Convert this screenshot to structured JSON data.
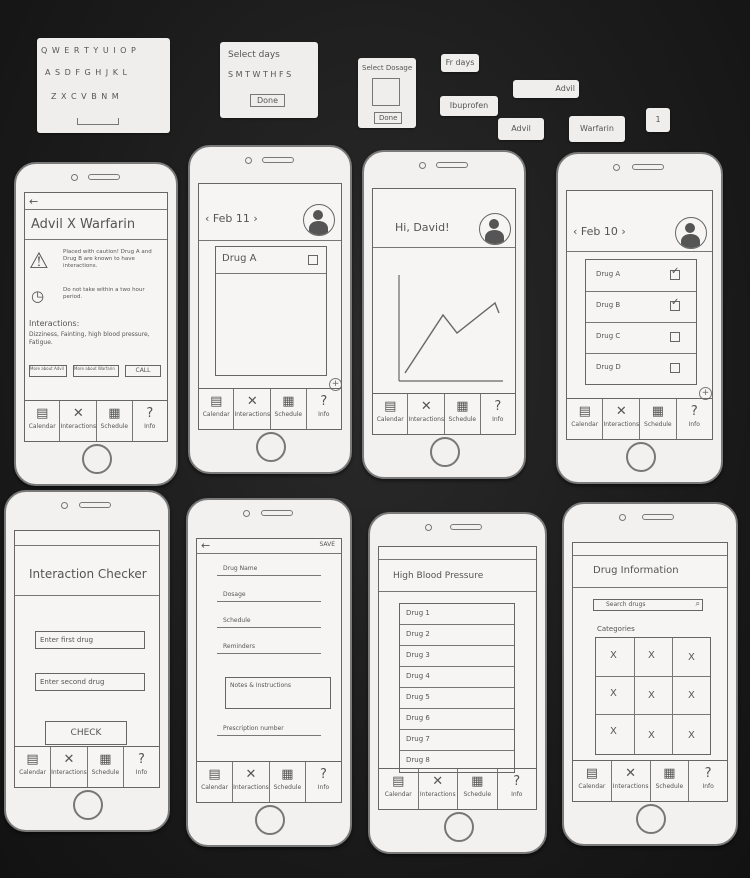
{
  "notes": {
    "keyboard_rows": [
      "Q W E R T Y U I O P",
      "A S D F G H J K L",
      "Z X C V B N M"
    ],
    "select_days_title": "Select days",
    "select_days_letters": "S M T W T H F S",
    "select_days_done": "Done",
    "select_dosage_title": "Select Dosage",
    "select_dosage_done": "Done",
    "tag_friday": "Fr days",
    "tag_ibuprofen": "Ibuprofen",
    "tag_advil_a": "Advil",
    "tag_advil_b": "Advil",
    "tag_warfarin": "Warfarin",
    "tag_one": "1"
  },
  "tabs": [
    "Calendar",
    "Interactions",
    "Schedule",
    "Info"
  ],
  "screens": {
    "interaction_detail": {
      "title": "Advil X Warfarin",
      "warning": "Placed with caution! Drug A and Drug B are known to have interactions.",
      "time_note": "Do not take within a two hour period.",
      "interactions_label": "Interactions:",
      "interactions_text": "Dizziness, Fainting, high blood pressure, Fatigue.",
      "btn_more_advil": "More about Advil",
      "btn_more_warfarin": "More about Warfarin",
      "btn_call": "CALL"
    },
    "calendar_a": {
      "date": "Feb 11",
      "drug": "Drug A"
    },
    "greeting": {
      "title": "Hi, David!"
    },
    "calendar_b": {
      "date": "Feb 10",
      "drugs": [
        "Drug A",
        "Drug B",
        "Drug C",
        "Drug D"
      ],
      "checked": [
        true,
        true,
        false,
        false
      ]
    },
    "checker": {
      "title": "Interaction Checker",
      "first_placeholder": "Enter first drug",
      "second_placeholder": "Enter second drug",
      "check": "CHECK"
    },
    "add_drug": {
      "save": "SAVE",
      "fields": [
        "Drug Name",
        "Dosage",
        "Schedule",
        "Reminders"
      ],
      "notes": "Notes & Instructions",
      "prescription": "Prescription number"
    },
    "condition": {
      "title": "High Blood Pressure",
      "drugs": [
        "Drug 1",
        "Drug 2",
        "Drug 3",
        "Drug 4",
        "Drug 5",
        "Drug 6",
        "Drug 7",
        "Drug 8"
      ]
    },
    "info": {
      "title": "Drug Information",
      "search": "Search drugs",
      "categories": "Categories",
      "grid_mark": "X"
    }
  }
}
